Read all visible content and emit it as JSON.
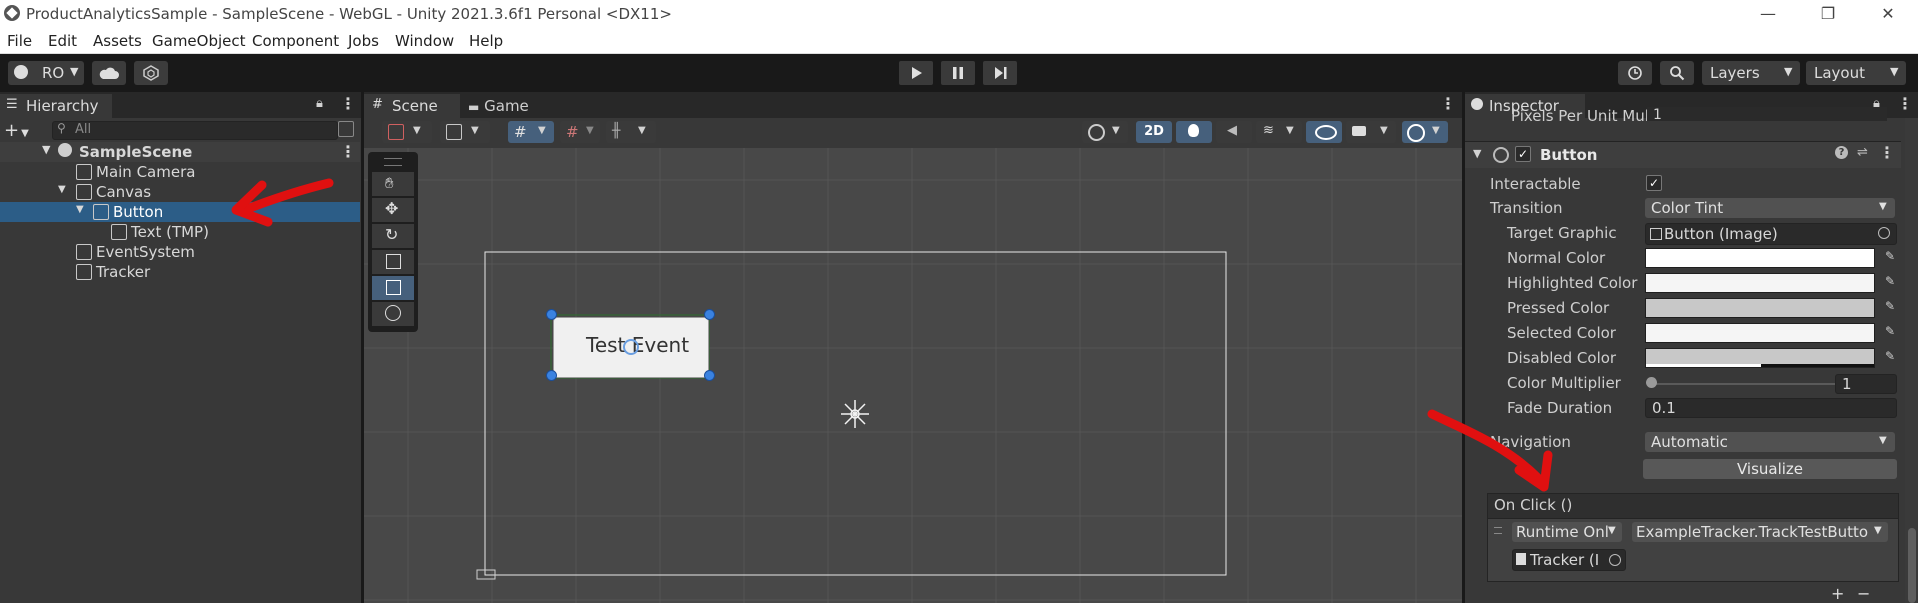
{
  "window": {
    "title": "ProductAnalyticsSample - SampleScene - WebGL - Unity 2021.3.6f1 Personal <DX11>",
    "controls": [
      "—",
      "❐",
      "✕"
    ]
  },
  "menu": [
    "File",
    "Edit",
    "Assets",
    "GameObject",
    "Component",
    "Jobs",
    "Window",
    "Help"
  ],
  "toolbar": {
    "account_label": "RO",
    "layers_label": "Layers",
    "layout_label": "Layout"
  },
  "hierarchy": {
    "tab_label": "Hierarchy",
    "search_placeholder": "All",
    "scene_name": "SampleScene",
    "items": [
      {
        "label": "Main Camera"
      },
      {
        "label": "Canvas"
      },
      {
        "label": "Button"
      },
      {
        "label": "Text (TMP)"
      },
      {
        "label": "EventSystem"
      },
      {
        "label": "Tracker"
      }
    ]
  },
  "scene": {
    "tabs": [
      "Scene",
      "Game"
    ],
    "mode_2d_label": "2D",
    "button_text": "Test Event"
  },
  "inspector": {
    "tab_label": "Inspector",
    "clipped_field": "Pixels Per Unit Mul",
    "clipped_value": "1",
    "component_title": "Button",
    "interactable_label": "Interactable",
    "interactable_check": "✓",
    "transition_label": "Transition",
    "transition_value": "Color Tint",
    "target_graphic_label": "Target Graphic",
    "target_graphic_value": "Button (Image)",
    "normal_color_label": "Normal Color",
    "highlighted_color_label": "Highlighted Color",
    "pressed_color_label": "Pressed Color",
    "selected_color_label": "Selected Color",
    "disabled_color_label": "Disabled Color",
    "color_multiplier_label": "Color Multiplier",
    "color_multiplier_value": "1",
    "fade_duration_label": "Fade Duration",
    "fade_duration_value": "0.1",
    "navigation_label": "Navigation",
    "navigation_value": "Automatic",
    "visualize_label": "Visualize",
    "onclick_label": "On Click ()",
    "runtime_value": "Runtime Onl",
    "function_value": "ExampleTracker.TrackTestButto",
    "object_value": "Tracker (I",
    "add_label": "+",
    "remove_label": "−"
  },
  "colors": {
    "selection": "#2c5d87",
    "annotation_arrow": "#e01010",
    "panel_bg": "#383838"
  }
}
